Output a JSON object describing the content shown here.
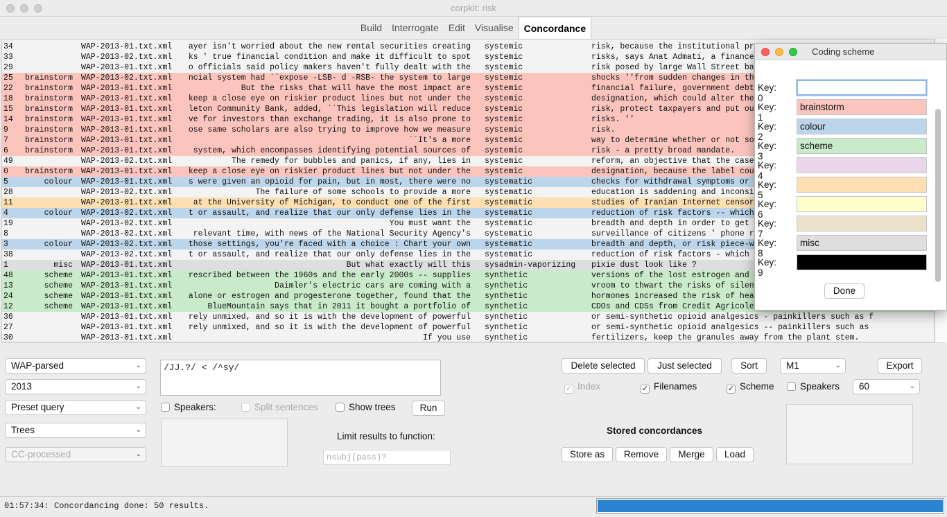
{
  "window": {
    "title": "corpkit: risk"
  },
  "tabs": [
    "Build",
    "Interrogate",
    "Edit",
    "Visualise",
    "Concordance"
  ],
  "active_tab": "Concordance",
  "colors": {
    "brainstorm": "#fbc5bd",
    "colour": "#bcd5ea",
    "scheme": "#c9ebc9",
    "misc": "#dedede",
    "key4": "#e9d6eb",
    "key5": "#fddfb2",
    "key6": "#ffffcc",
    "key7": "#ece2cc",
    "key9": "#000000",
    "none": "#f3f3f3",
    "progress": "#2b84d2"
  },
  "concordance": {
    "rows": [
      {
        "idx": "34",
        "code": "",
        "file": "WAP-2013-01.txt.xml",
        "left": "ayer isn't worried about the new rental securities creating",
        "mid": "systemic",
        "right": "risk, because the institutional pr"
      },
      {
        "idx": "33",
        "code": "",
        "file": "WAP-2013-02.txt.xml",
        "left": "ks ' true financial condition and make it difficult to spot",
        "mid": "systemic",
        "right": "risks, says Anat Admati, a finance"
      },
      {
        "idx": "29",
        "code": "",
        "file": "WAP-2013-01.txt.xml",
        "left": "o officials said policy makers haven't fully dealt with the",
        "mid": "systemic",
        "right": "risk posed by large Wall Street ba"
      },
      {
        "idx": "25",
        "code": "brainstorm",
        "file": "WAP-2013-02.txt.xml",
        "left": "ncial system had ``expose -LSB- d -RSB- the system to large",
        "mid": "systemic",
        "right": "shocks ''from sudden changes in th"
      },
      {
        "idx": "22",
        "code": "brainstorm",
        "file": "WAP-2013-01.txt.xml",
        "left": "But the risks that will have the most impact are",
        "mid": "systemic",
        "right": "financial failure, government debt"
      },
      {
        "idx": "18",
        "code": "brainstorm",
        "file": "WAP-2013-01.txt.xml",
        "left": "keep a close eye on riskier product lines but not under the",
        "mid": "systemic",
        "right": "designation, which could alter the"
      },
      {
        "idx": "15",
        "code": "brainstorm",
        "file": "WAP-2013-01.txt.xml",
        "left": "leton Community Bank, added, ``This legislation will reduce",
        "mid": "systemic",
        "right": "risk, protect taxpayers and put ou"
      },
      {
        "idx": "14",
        "code": "brainstorm",
        "file": "WAP-2013-01.txt.xml",
        "left": "ve for investors than exchange trading, it is also prone to",
        "mid": "systemic",
        "right": "risks. ''"
      },
      {
        "idx": "9",
        "code": "brainstorm",
        "file": "WAP-2013-01.txt.xml",
        "left": "ose same scholars are also trying to improve how we measure",
        "mid": "systemic",
        "right": "risk."
      },
      {
        "idx": "7",
        "code": "brainstorm",
        "file": "WAP-2013-01.txt.xml",
        "left": "``It's a more",
        "mid": "systemic",
        "right": "way to determine whether or not so"
      },
      {
        "idx": "6",
        "code": "brainstorm",
        "file": "WAP-2013-01.txt.xml",
        "left": "system, which encompasses identifying potential sources of",
        "mid": "systemic",
        "right": "risk - a pretty broad mandate."
      },
      {
        "idx": "49",
        "code": "",
        "file": "WAP-2013-02.txt.xml",
        "left": "The remedy for bubbles and panics, if any, lies in",
        "mid": "systemic",
        "right": "reform, an objective that the case"
      },
      {
        "idx": "0",
        "code": "brainstorm",
        "file": "WAP-2013-01.txt.xml",
        "left": "keep a close eye on riskier product lines but not under the",
        "mid": "systemic",
        "right": "designation, because the label cou"
      },
      {
        "idx": "5",
        "code": "colour",
        "file": "WAP-2013-01.txt.xml",
        "left": "s were given an opioid for pain, but in most, there were no",
        "mid": "systematic",
        "right": "checks for withdrawal symptoms or"
      },
      {
        "idx": "28",
        "code": "",
        "file": "WAP-2013-02.txt.xml",
        "left": "The failure of some schools to provide a more",
        "mid": "systematic",
        "right": "education is saddening and inconsi"
      },
      {
        "idx": "11",
        "code": "",
        "file": "WAP-2013-01.txt.xml",
        "left": "at the University of Michigan, to conduct one of the first",
        "mid": "systematic",
        "right": "studies of Iranian Internet censor"
      },
      {
        "idx": "4",
        "code": "colour",
        "file": "WAP-2013-02.txt.xml",
        "left": "t or assault, and realize that our only defense lies in the",
        "mid": "systematic",
        "right": "reduction of risk factors -- which"
      },
      {
        "idx": "19",
        "code": "",
        "file": "WAP-2013-02.txt.xml",
        "left": "You must want the",
        "mid": "systematic",
        "right": "breadth and depth in order to get"
      },
      {
        "idx": "8",
        "code": "",
        "file": "WAP-2013-02.txt.xml",
        "left": "relevant time, with news of the National Security Agency's",
        "mid": "systematic",
        "right": "surveillance of citizens ' phone r"
      },
      {
        "idx": "3",
        "code": "colour",
        "file": "WAP-2013-02.txt.xml",
        "left": "those settings, you're faced with a choice : Chart your own",
        "mid": "systematic",
        "right": "breadth and depth, or risk piece-w"
      },
      {
        "idx": "38",
        "code": "",
        "file": "WAP-2013-02.txt.xml",
        "left": "t or assault, and realize that our only defense lies in the",
        "mid": "systematic",
        "right": "reduction of risk factors - which"
      },
      {
        "idx": "1",
        "code": "misc",
        "file": "WAP-2013-01.txt.xml",
        "left": "But what exactly will this",
        "mid": "sysadmin-vaporizing",
        "right": "pixie dust look like ?"
      },
      {
        "idx": "48",
        "code": "scheme",
        "file": "WAP-2013-01.txt.xml",
        "left": "rescribed between the 1960s and the early 2000s -- supplies",
        "mid": "synthetic",
        "right": "versions of the lost estrogen and"
      },
      {
        "idx": "13",
        "code": "scheme",
        "file": "WAP-2013-01.txt.xml",
        "left": "Daimler's electric cars are coming with a",
        "mid": "synthetic",
        "right": "vroom to thwart the risks of silen"
      },
      {
        "idx": "24",
        "code": "scheme",
        "file": "WAP-2013-01.txt.xml",
        "left": "alone or estrogen and progesterone together, found that the",
        "mid": "synthetic",
        "right": "hormones increased the risk of hea"
      },
      {
        "idx": "12",
        "code": "scheme",
        "file": "WAP-2013-01.txt.xml",
        "left": "BlueMountain says that in 2011 it bought a portfolio of",
        "mid": "synthetic",
        "right": "CDOs and CDSs from Credit Agricole"
      },
      {
        "idx": "36",
        "code": "",
        "file": "WAP-2013-01.txt.xml",
        "left": "rely unmixed, and so it is with the development of powerful",
        "mid": "synthetic",
        "right": "or semi-synthetic opioid analgesics - painkillers such as f"
      },
      {
        "idx": "27",
        "code": "",
        "file": "WAP-2013-01.txt.xml",
        "left": "rely unmixed, and so it is with the development of powerful",
        "mid": "synthetic",
        "right": "or semi-synthetic opioid analgesics -- painkillers such as"
      },
      {
        "idx": "30",
        "code": "",
        "file": "WAP-2013-01.txt.xml",
        "left": "If you use",
        "mid": "synthetic",
        "right": "fertilizers, keep the granules away from the plant stem."
      }
    ],
    "row_bg": [
      "none",
      "none",
      "none",
      "brainstorm",
      "brainstorm",
      "brainstorm",
      "brainstorm",
      "brainstorm",
      "brainstorm",
      "brainstorm",
      "brainstorm",
      "none",
      "brainstorm",
      "colour",
      "none",
      "key5",
      "colour",
      "none",
      "none",
      "colour",
      "none",
      "misc",
      "scheme",
      "scheme",
      "scheme",
      "scheme",
      "none",
      "none",
      "none"
    ]
  },
  "controls": {
    "corpus_select": "WAP-parsed",
    "subcorpus_select": "2013",
    "preset_select": "Preset query",
    "search_type_select": "Trees",
    "processed_select": "CC-processed",
    "query_text": "/JJ.?/ < /^sy/",
    "speakers_label": "Speakers:",
    "split_sentences_label": "Split sentences",
    "show_trees_label": "Show trees",
    "run_label": "Run",
    "limit_label": "Limit results to function:",
    "limit_placeholder": "nsubj(pass)?",
    "delete_selected": "Delete selected",
    "just_selected": "Just selected",
    "sort": "Sort",
    "sort_select": "M1",
    "export": "Export",
    "index_label": "Index",
    "filenames_label": "Filenames",
    "scheme_label": "Scheme",
    "speakers_show_label": "Speakers",
    "window_select": "60",
    "stored_title": "Stored concordances",
    "store_as": "Store as",
    "remove": "Remove",
    "merge": "Merge",
    "load": "Load"
  },
  "checks": {
    "index": true,
    "filenames": true,
    "scheme": true,
    "speakers_show": false,
    "speakers": false,
    "split": false,
    "show_trees": false
  },
  "status": {
    "text": "01:57:34: Concordancing done: 50 results.",
    "progress": 1.0
  },
  "dialog": {
    "title": "Coding scheme",
    "keys": [
      {
        "label": "Key: 0",
        "value": "",
        "color": "#ffffff"
      },
      {
        "label": "Key: 1",
        "value": "brainstorm",
        "color": "#fbc5bd"
      },
      {
        "label": "Key: 2",
        "value": "colour",
        "color": "#bcd5ea"
      },
      {
        "label": "Key: 3",
        "value": "scheme",
        "color": "#c9ebc9"
      },
      {
        "label": "Key: 4",
        "value": "",
        "color": "#e9d6eb"
      },
      {
        "label": "Key: 5",
        "value": "",
        "color": "#fddfb2"
      },
      {
        "label": "Key: 6",
        "value": "",
        "color": "#ffffcc"
      },
      {
        "label": "Key: 7",
        "value": "",
        "color": "#ece2cc"
      },
      {
        "label": "Key: 8",
        "value": "misc",
        "color": "#dedede"
      },
      {
        "label": "Key: 9",
        "value": "",
        "color": "#000000"
      }
    ],
    "done_label": "Done"
  }
}
